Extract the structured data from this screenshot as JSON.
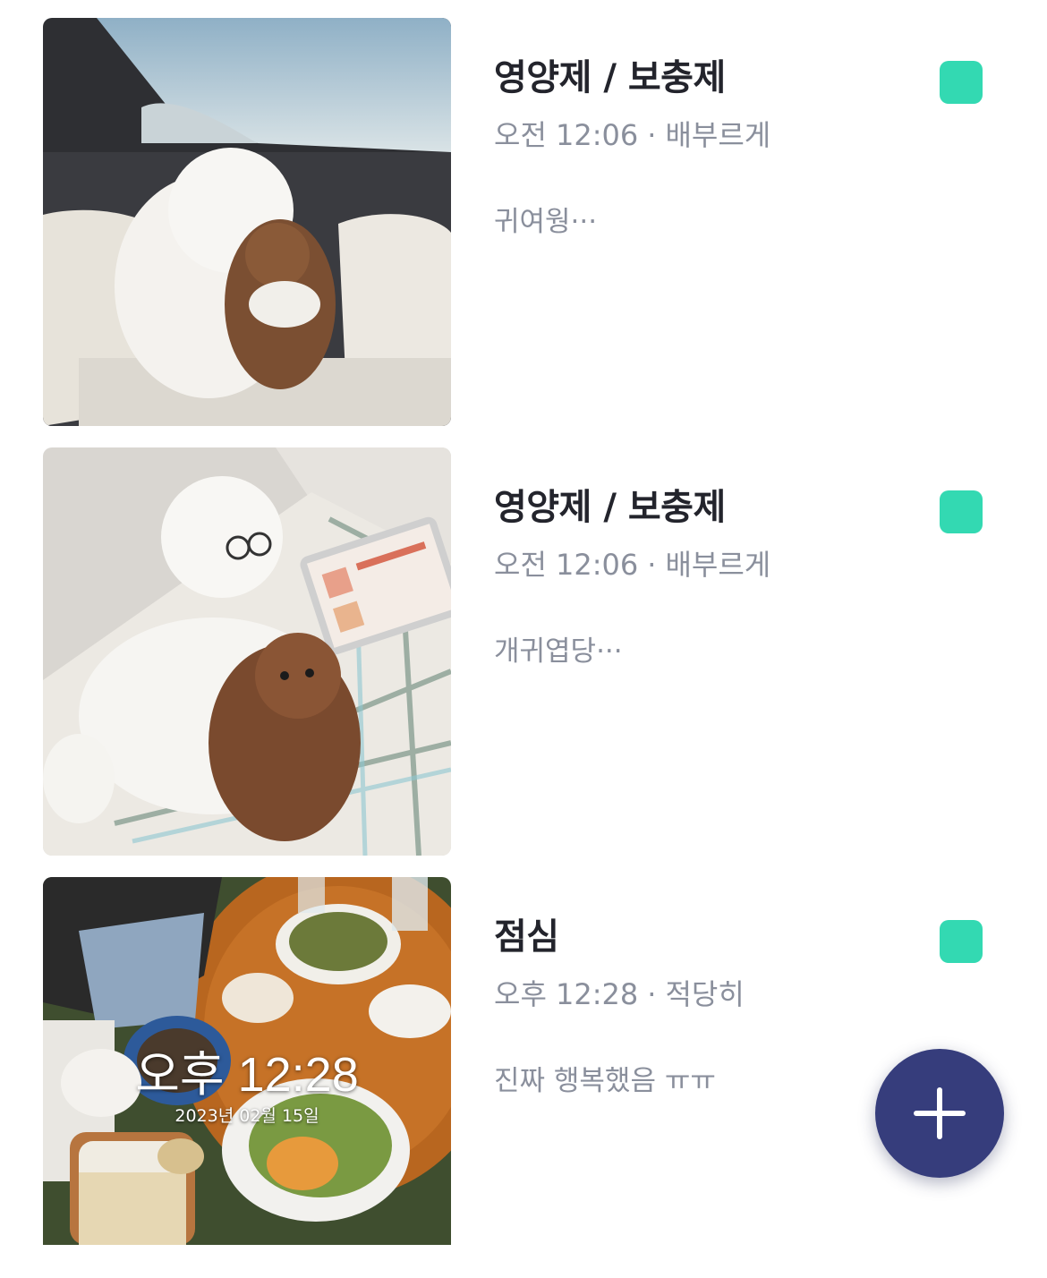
{
  "colors": {
    "title": "#23242c",
    "meta": "#8a8f9c",
    "tag_mint": "#33d9b2",
    "fab_navy": "#363d7c",
    "fab_plus": "#ffffff"
  },
  "entries": [
    {
      "title": "영양제 / 보충제",
      "time": "오전 12:06",
      "separator": "·",
      "appetite": "배부르게",
      "memo": "귀여웡···",
      "photo_icon": "dogs-in-car-seat-photo",
      "tag_color": "#33d9b2"
    },
    {
      "title": "영양제 / 보충제",
      "time": "오전 12:06",
      "separator": "·",
      "appetite": "배부르게",
      "memo": "개귀엽당···",
      "photo_icon": "dogs-with-tablet-photo",
      "tag_color": "#33d9b2"
    },
    {
      "title": "점심",
      "time": "오후 12:28",
      "separator": "·",
      "appetite": "적당히",
      "memo": "진짜 행복했음 ㅠㅠ",
      "photo_icon": "lunch-table-photo",
      "photo_overlay_time": "오후 12:28",
      "photo_overlay_date": "2023년 02월 15일",
      "tag_color": "#33d9b2"
    }
  ],
  "fab": {
    "icon": "plus-icon"
  }
}
